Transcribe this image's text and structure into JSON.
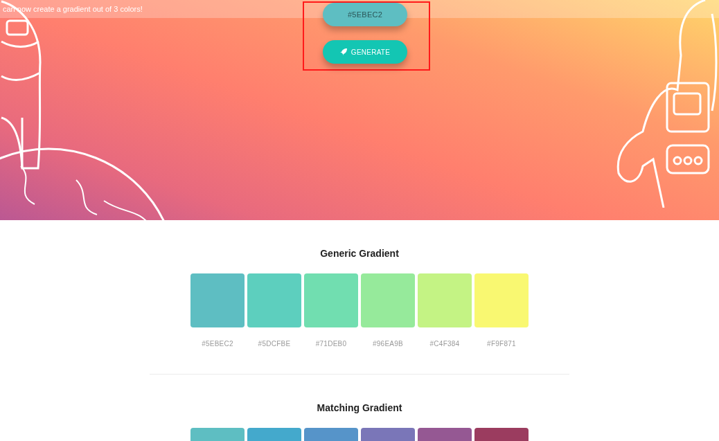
{
  "banner": {
    "text": "can now create a gradient out of 3 colors!"
  },
  "color_button": {
    "label": "#5EBEC2",
    "color": "#5ebec2"
  },
  "generate_button": {
    "label": "GENERATE"
  },
  "sections": [
    {
      "title": "Generic Gradient",
      "swatches": [
        {
          "color": "#5ebec2",
          "label": "#5EBEC2"
        },
        {
          "color": "#5dcfbe",
          "label": "#5DCFBE"
        },
        {
          "color": "#71deb0",
          "label": "#71DEB0"
        },
        {
          "color": "#96ea9b",
          "label": "#96EA9B"
        },
        {
          "color": "#c4f384",
          "label": "#C4F384"
        },
        {
          "color": "#f9f871",
          "label": "#F9F871"
        }
      ]
    },
    {
      "title": "Matching Gradient",
      "swatches": [
        {
          "color": "#5ebec2"
        },
        {
          "color": "#44a9cc"
        },
        {
          "color": "#5694c9"
        },
        {
          "color": "#7a76b8"
        },
        {
          "color": "#955893"
        },
        {
          "color": "#9b3c5f"
        }
      ]
    }
  ]
}
